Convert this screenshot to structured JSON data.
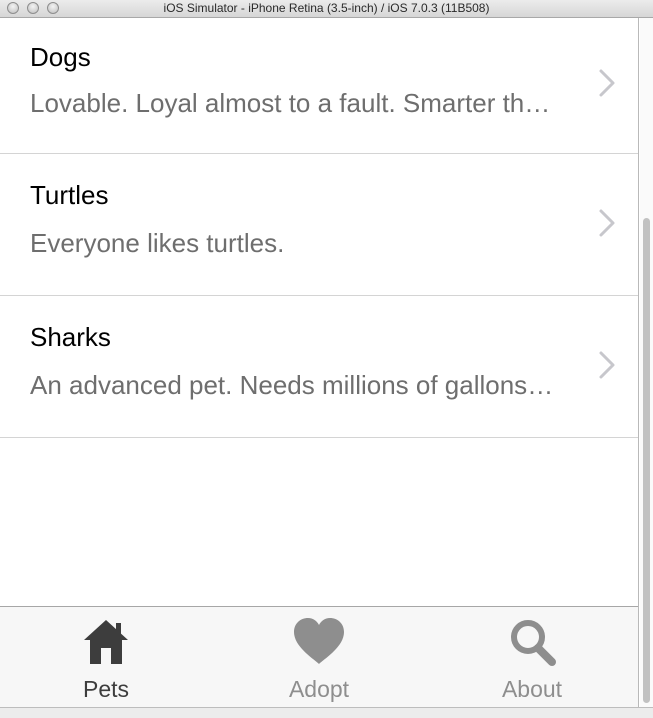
{
  "window": {
    "title": "iOS Simulator - iPhone Retina (3.5-inch) / iOS 7.0.3 (11B508)"
  },
  "list": {
    "rows": [
      {
        "title": "Dogs",
        "subtitle": "Lovable. Loyal almost to a fault. Smarter than they look."
      },
      {
        "title": "Turtles",
        "subtitle": "Everyone likes turtles."
      },
      {
        "title": "Sharks",
        "subtitle": "An advanced pet. Needs millions of gallons of salt water."
      }
    ]
  },
  "tabbar": {
    "tabs": [
      {
        "label": "Pets",
        "icon": "home-icon",
        "active": true
      },
      {
        "label": "Adopt",
        "icon": "heart-icon",
        "active": false
      },
      {
        "label": "About",
        "icon": "search-icon",
        "active": false
      }
    ]
  },
  "colors": {
    "active_tab": "#3d3d3d",
    "inactive_tab": "#8e8e8e",
    "subtitle": "#6e6e6e",
    "separator": "#d4d4d4",
    "chevron": "#c7c7cc"
  }
}
